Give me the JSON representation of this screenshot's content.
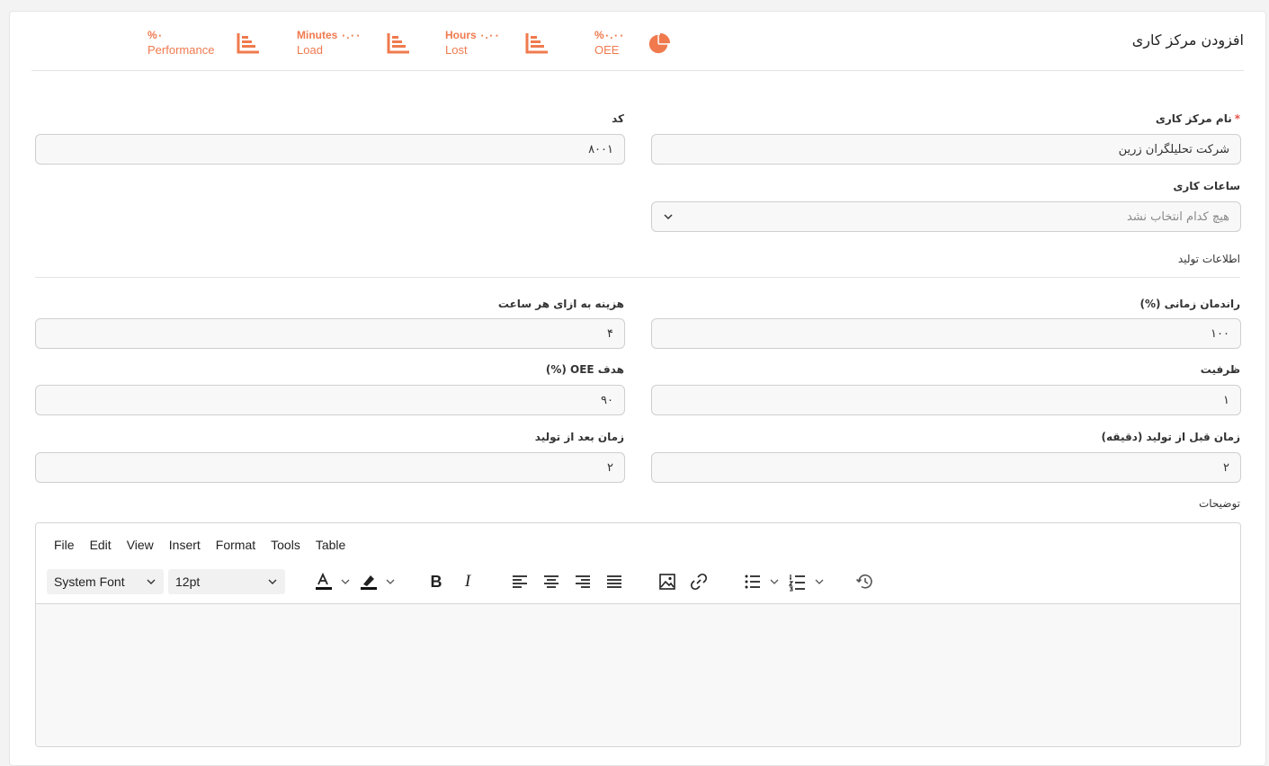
{
  "page": {
    "title": "افزودن مرکز کاری"
  },
  "stats": [
    {
      "value": "%۰.۰۰",
      "label": "OEE",
      "icon": "pie-chart-icon"
    },
    {
      "value": "Hours ۰.۰۰",
      "label": "Lost",
      "icon": "bar-chart-icon"
    },
    {
      "value": "Minutes ۰.۰۰",
      "label": "Load",
      "icon": "bar-chart-icon"
    },
    {
      "value": "%۰",
      "label": "Performance",
      "icon": "bar-chart-icon"
    }
  ],
  "form": {
    "name": {
      "label": "نام مرکز کاری",
      "required_mark": "*",
      "value": "شرکت تحلیلگران زرین"
    },
    "code": {
      "label": "کد",
      "value": "۸۰۰۱"
    },
    "working_hours": {
      "label": "ساعات کاری",
      "placeholder": "هیچ کدام انتخاب نشد"
    },
    "production_section": "اطلاعات تولید",
    "time_efficiency": {
      "label": "راندمان زمانی (%)",
      "value": "۱۰۰"
    },
    "cost_per_hour": {
      "label": "هزینه به ازای هر ساعت",
      "value": "۴"
    },
    "capacity": {
      "label": "ظرفیت",
      "value": "۱"
    },
    "oee_target": {
      "label": "هدف OEE (%)",
      "value": "۹۰"
    },
    "time_before": {
      "label": "زمان قبل از تولید (دقیقه)",
      "value": "۲"
    },
    "time_after": {
      "label": "زمان بعد از تولید",
      "value": "۲"
    },
    "description_label": "توضیحات"
  },
  "editor": {
    "menus": [
      "File",
      "Edit",
      "View",
      "Insert",
      "Format",
      "Tools",
      "Table"
    ],
    "font_family": "System Font",
    "font_size": "12pt",
    "bold": "B",
    "italic": "I"
  },
  "colors": {
    "accent": "#f07a4e",
    "border": "#cfcfcf",
    "field_bg": "#f8f8f8",
    "required": "#e5534b"
  }
}
